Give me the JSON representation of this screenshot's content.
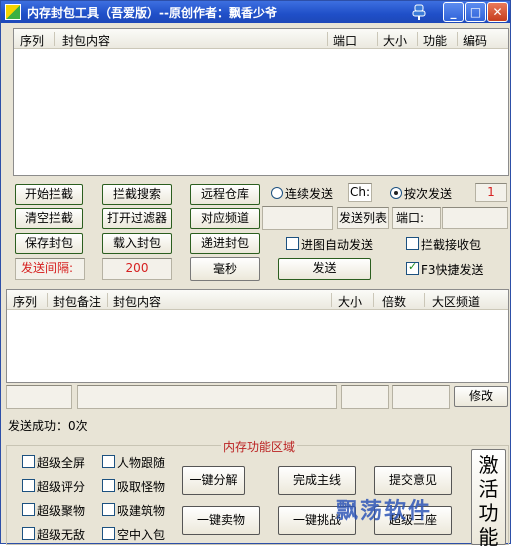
{
  "titlebar": {
    "title": "内存封包工具（吾爱版）--原创作者：飘香少爷",
    "min": "_",
    "max": "□",
    "close": "✕"
  },
  "packets_table": {
    "columns": [
      "序列",
      "封包内容",
      "端口",
      "大小",
      "功能",
      "编码"
    ]
  },
  "buttons": {
    "start_intercept": "开始拦截",
    "intercept_search": "拦截搜索",
    "remote_repo": "远程仓库",
    "clear_intercept": "清空拦截",
    "open_filter": "打开过滤器",
    "corresponding_channel": "对应频道",
    "save_packet": "保存封包",
    "load_packet": "载入封包",
    "send_in_packet": "递进封包",
    "ms": "毫秒",
    "send": "发送",
    "modify": "修改"
  },
  "options": {
    "continuous_send": "连续发送",
    "ch_label": "Ch:",
    "send_count_mode": "按次发送",
    "send_count": "1",
    "send_list": "发送列表",
    "port_label": "端口:",
    "auto_send_on_enter": "进图自动发送",
    "auto_send_on_enter_checked": false,
    "intercept_receive": "拦截接收包",
    "intercept_receive_checked": false,
    "f3_quick_send": "F3快捷发送",
    "f3_quick_send_checked": true,
    "interval_label": "发送间隔:",
    "interval_value": "200"
  },
  "send_table": {
    "columns": [
      "序列",
      "封包备注",
      "封包内容",
      "大小",
      "倍数",
      "大区频道"
    ]
  },
  "status": {
    "text": "发送成功：0次"
  },
  "memory": {
    "title": "内存功能区域",
    "checks": [
      "超级全屏",
      "人物跟随",
      "超级评分",
      "吸取怪物",
      "超级聚物",
      "吸建筑物",
      "超级无敌",
      "空中入包"
    ],
    "actions": [
      "一键分解",
      "完成主线",
      "提交意见",
      "一键卖物",
      "一键挑战",
      "超级三座"
    ],
    "activate": "激活功能"
  },
  "watermark": "飘荡软件"
}
